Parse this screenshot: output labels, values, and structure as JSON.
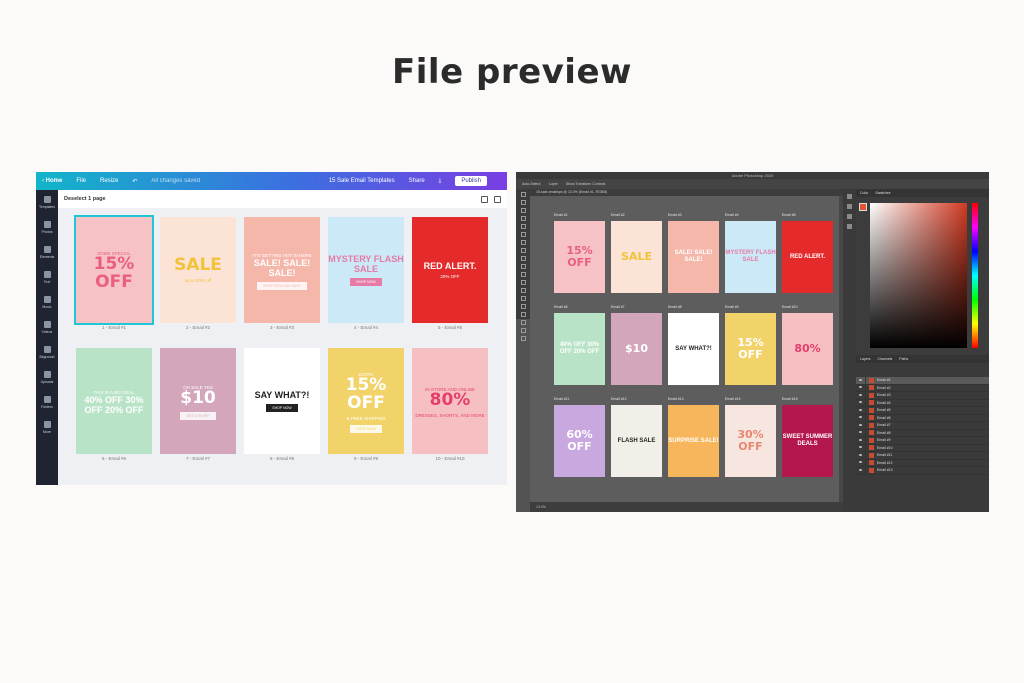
{
  "page": {
    "title": "File preview"
  },
  "canva": {
    "nav": {
      "home": "Home",
      "file": "File",
      "resize": "Resize",
      "undo_icon": "undo-icon",
      "status": "All changes saved"
    },
    "doc_title": "15 Sale Email Templates",
    "share": "Share",
    "publish": "Publish",
    "deselect": "Deselect 1 page",
    "sidebar": [
      "Templates",
      "Photos",
      "Elements",
      "Text",
      "Music",
      "Videos",
      "Bkground",
      "Uploads",
      "Folders",
      "More"
    ],
    "cards": [
      {
        "top": "SOME SPECIAL",
        "headline": "15% OFF",
        "caption": "1 - Email #1",
        "bg": "#f7c2c6",
        "fg": "#e95f7d",
        "btn": ""
      },
      {
        "top": "",
        "headline": "SALE",
        "sub": "up to 50% off",
        "caption": "2 - Email #2",
        "bg": "#fbe3d5",
        "fg": "#f3c23b",
        "btn": ""
      },
      {
        "top": "IT'S GETTING HOT IN HERE",
        "headline": "SALE! SALE! SALE!",
        "caption": "3 - Email #3",
        "bg": "#f6b7ab",
        "fg": "#ffffff",
        "btn": "SHOP NOW AND SAVE"
      },
      {
        "top": "",
        "headline": "MYSTERY FLASH SALE",
        "caption": "4 - Email #4",
        "bg": "#cbe9f7",
        "fg": "#e57ba6",
        "btn": "SHOP NOW"
      },
      {
        "top": "",
        "headline": "RED ALERT.",
        "sub": "20% OFF",
        "caption": "5 - Email #5",
        "bg": "#e42a2a",
        "fg": "#ffffff",
        "btn": ""
      },
      {
        "top": "THIS IS A BIG DEAL",
        "headline": "40% OFF 30% OFF 20% OFF",
        "caption": "6 - Email #6",
        "bg": "#b9e3c6",
        "fg": "#ffffff",
        "btn": ""
      },
      {
        "top": "OH SALE YES",
        "headline": "$10",
        "caption": "7 - Email #7",
        "bg": "#d3a6bc",
        "fg": "#ffffff",
        "btn": "GET 10% OFF"
      },
      {
        "top": "",
        "headline": "SAY WHAT?!",
        "caption": "8 - Email #8",
        "bg": "#ffffff",
        "fg": "#222222",
        "btn": "SHOP NOW"
      },
      {
        "top": "EXTRA",
        "headline": "15% OFF",
        "sub": "& FREE SHIPPING",
        "caption": "9 - Email #9",
        "bg": "#f1d36a",
        "fg": "#ffffff",
        "btn": "SHOP NOW"
      },
      {
        "top": "IN-STORE AND ONLINE",
        "headline": "80%",
        "sub": "DRESSES, SHORTS, AND MORE",
        "caption": "10 - Email #10",
        "bg": "#f6c0c3",
        "fg": "#e53e6c",
        "btn": ""
      }
    ]
  },
  "photoshop": {
    "app_title": "Adobe Photoshop 2020",
    "options": [
      "Auto-Select:",
      "Layer",
      "Show Transform Controls"
    ],
    "doc_tab": "15-sale-emailsps @ 13.0% (Email #1, RGB/8)",
    "status": "13.0%",
    "panel_tabs": [
      "Color",
      "Swatches"
    ],
    "layers_tabs": [
      "Layers",
      "Channels",
      "Paths"
    ],
    "layers": [
      "Email #1",
      "Email #2",
      "Email #3",
      "Email #4",
      "Email #5",
      "Email #6",
      "Email #7",
      "Email #8",
      "Email #9",
      "Email #10",
      "Email #11",
      "Email #12",
      "Email #13"
    ],
    "cards": [
      {
        "label": "Email #1",
        "headline": "15% OFF",
        "bg": "#f7c2c6",
        "fg": "#e95f7d"
      },
      {
        "label": "Email #2",
        "headline": "SALE",
        "bg": "#fbe3d5",
        "fg": "#f3c23b"
      },
      {
        "label": "Email #3",
        "headline": "SALE! SALE! SALE!",
        "bg": "#f6b7ab",
        "fg": "#ffffff"
      },
      {
        "label": "Email #4",
        "headline": "MYSTERY FLASH SALE",
        "bg": "#cbe9f7",
        "fg": "#e57ba6"
      },
      {
        "label": "Email #5",
        "headline": "RED ALERT.",
        "bg": "#e42a2a",
        "fg": "#ffffff"
      },
      {
        "label": "Email #6",
        "headline": "40% OFF 30% OFF 20% OFF",
        "bg": "#b9e3c6",
        "fg": "#ffffff"
      },
      {
        "label": "Email #7",
        "headline": "$10",
        "bg": "#d3a6bc",
        "fg": "#ffffff"
      },
      {
        "label": "Email #8",
        "headline": "SAY WHAT?!",
        "bg": "#ffffff",
        "fg": "#222222"
      },
      {
        "label": "Email #9",
        "headline": "15% OFF",
        "bg": "#f1d36a",
        "fg": "#ffffff"
      },
      {
        "label": "Email #10",
        "headline": "80%",
        "bg": "#f6c0c3",
        "fg": "#e53e6c"
      },
      {
        "label": "Email #11",
        "headline": "60% OFF",
        "bg": "#c9a8e0",
        "fg": "#ffffff"
      },
      {
        "label": "Email #12",
        "headline": "FLASH SALE",
        "bg": "#f2efe9",
        "fg": "#222222"
      },
      {
        "label": "Email #13",
        "headline": "SURPRISE SALE!",
        "bg": "#f7b65c",
        "fg": "#ffffff"
      },
      {
        "label": "Email #14",
        "headline": "30% OFF",
        "bg": "#f7e6df",
        "fg": "#e8866e"
      },
      {
        "label": "Email #15",
        "headline": "SWEET SUMMER DEALS",
        "bg": "#b3174e",
        "fg": "#ffffff"
      }
    ]
  }
}
